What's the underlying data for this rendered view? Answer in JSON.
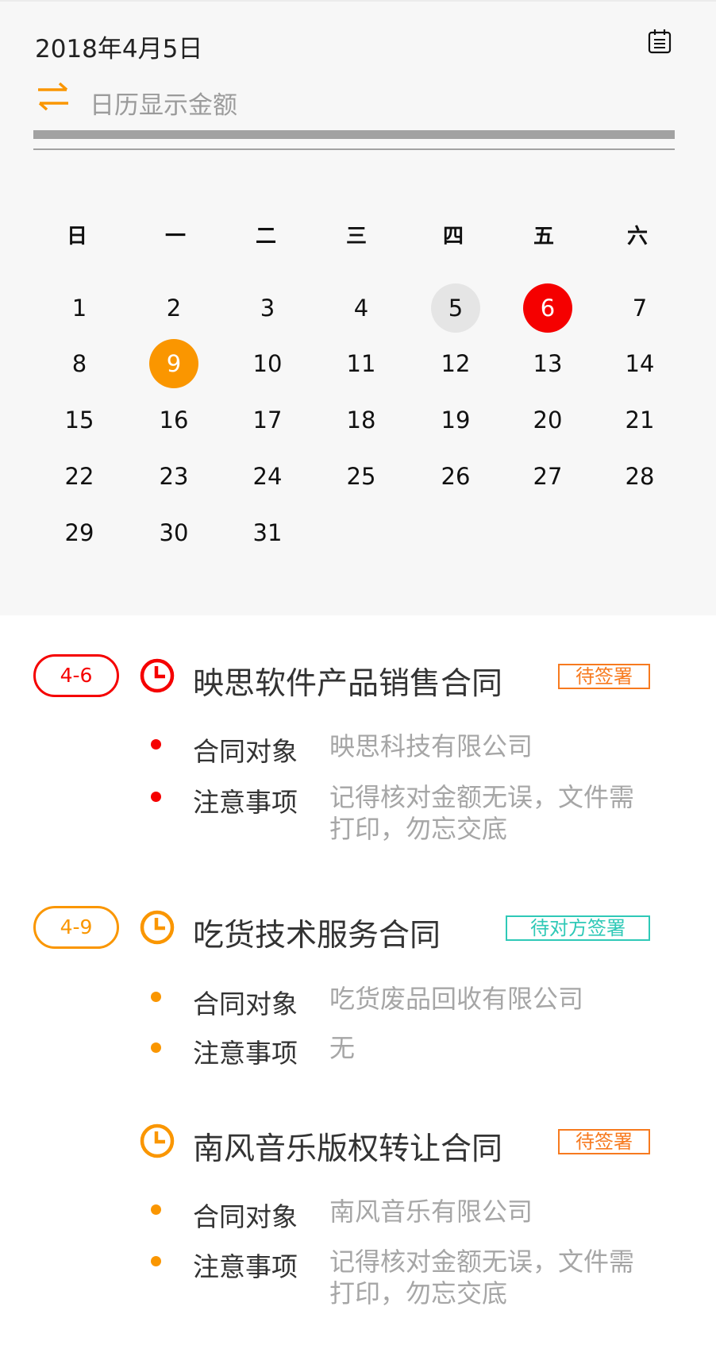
{
  "header": {
    "date": "2018年4月5日",
    "toggle_label": "日历显示金额"
  },
  "calendar": {
    "weekdays": [
      "日",
      "一",
      "二",
      "三",
      "四",
      "五",
      "六"
    ],
    "days": [
      "1",
      "2",
      "3",
      "4",
      "5",
      "6",
      "7",
      "8",
      "9",
      "10",
      "11",
      "12",
      "13",
      "14",
      "15",
      "16",
      "17",
      "18",
      "19",
      "20",
      "21",
      "22",
      "23",
      "24",
      "25",
      "26",
      "27",
      "28",
      "29",
      "30",
      "31"
    ],
    "today": "5",
    "marked_red": "6",
    "marked_orange": "9"
  },
  "colors": {
    "red": "#f50000",
    "orange": "#fa9600",
    "teal": "#2fc9b7",
    "tag_orange": "#f77a1f",
    "grey_text": "#a6a6a6"
  },
  "groups": [
    {
      "date": "4-6",
      "color": "#f50000",
      "contracts": [
        {
          "title": "映思软件产品销售合同",
          "status": "待签署",
          "fields": [
            {
              "label": "合同对象",
              "value": "映思科技有限公司"
            },
            {
              "label": "注意事项",
              "value": "记得核对金额无误，文件需打印，勿忘交底"
            }
          ]
        }
      ]
    },
    {
      "date": "4-9",
      "color": "#fa9600",
      "contracts": [
        {
          "title": "吃货技术服务合同",
          "status": "待对方签署",
          "fields": [
            {
              "label": "合同对象",
              "value": "吃货废品回收有限公司"
            },
            {
              "label": "注意事项",
              "value": "无"
            }
          ]
        },
        {
          "title": "南风音乐版权转让合同",
          "status": "待签署",
          "fields": [
            {
              "label": "合同对象",
              "value": "南风音乐有限公司"
            },
            {
              "label": "注意事项",
              "value": "记得核对金额无误，文件需打印，勿忘交底"
            }
          ]
        }
      ]
    }
  ]
}
